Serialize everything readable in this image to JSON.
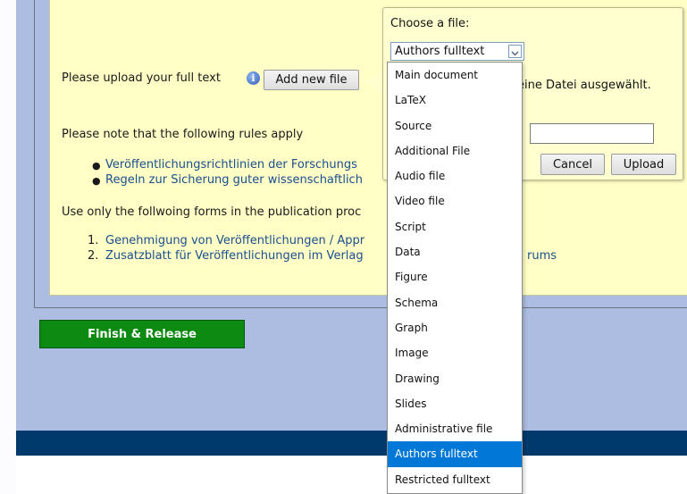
{
  "main": {
    "upload_label": "Please upload your full text",
    "add_file_label": "Add new file",
    "rules_label": "Please note that the following rules apply",
    "rules_links": [
      "Veröffentlichungsrichtlinien der Forschungs",
      "Regeln zur Sicherung guter wissenschaftlich"
    ],
    "forms_label": "Use only the follwoing forms in the publication proc",
    "forms_items": [
      {
        "num": "1.",
        "text": "Genehmigung von Veröffentlichungen / Appr"
      },
      {
        "num": "2.",
        "text": "Zusatzblatt für Veröffentlichungen im Verlag"
      }
    ],
    "forms_tail": "rums",
    "finish_label": "Finish & Release"
  },
  "popup": {
    "title": "Choose a file:",
    "selected_type": "Authors fulltext",
    "no_file_text": "eine Datei ausgewählt.",
    "cancel_label": "Cancel",
    "upload_label": "Upload"
  },
  "dropdown": {
    "options": [
      "Main document",
      "LaTeX",
      "Source",
      "Additional File",
      "Audio file",
      "Video file",
      "Script",
      "Data",
      "Figure",
      "Schema",
      "Graph",
      "Image",
      "Drawing",
      "Slides",
      "Administrative file",
      "Authors fulltext",
      "Restricted fulltext"
    ],
    "selected_index": 15
  },
  "icons": {
    "info": "info-icon",
    "bullet": "bullet-icon",
    "chevron": "chevron-down-icon"
  },
  "colors": {
    "page_bg": "#adbde1",
    "panel_bg": "#ffffc6",
    "popup_bg": "#ffffd0",
    "link": "#1a4f8f",
    "finish_button": "#0d8a12",
    "footer": "#003a6c",
    "selected_option": "#0078d7"
  }
}
